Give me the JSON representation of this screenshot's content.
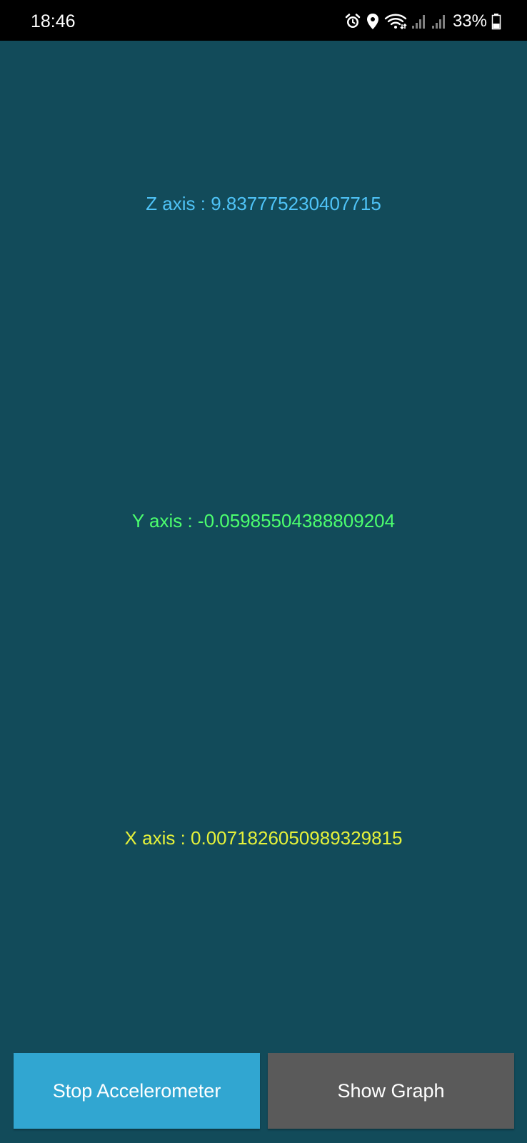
{
  "status_bar": {
    "time": "18:46",
    "battery_percent": "33%",
    "icons": [
      "alarm-icon",
      "location-icon",
      "wifi-icon",
      "signal-icon",
      "signal-icon",
      "battery-icon"
    ]
  },
  "readings": {
    "z": "Z axis : 9.837775230407715",
    "y": "Y axis : -0.05985504388809204",
    "x": "X axis : 0.0071826050989329815"
  },
  "buttons": {
    "stop": "Stop Accelerometer",
    "graph": "Show Graph"
  },
  "colors": {
    "background": "#124b5a",
    "z_text": "#4fc3f7",
    "y_text": "#4cff6e",
    "x_text": "#e6f23a",
    "stop_button": "#31a6d1",
    "graph_button": "#5a5a5a"
  }
}
